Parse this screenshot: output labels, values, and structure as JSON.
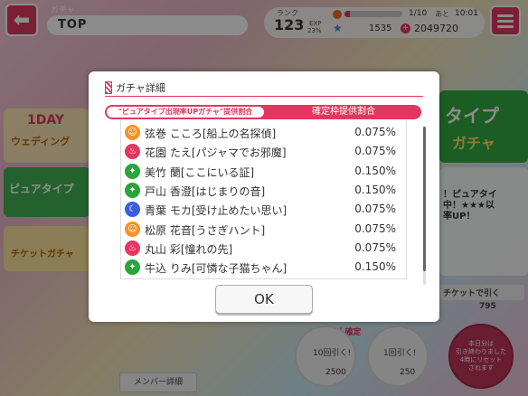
{
  "header": {
    "section_label": "ガチャ",
    "breadcrumb": "TOP"
  },
  "status": {
    "rank_label": "ランク",
    "rank": "123",
    "exp_label": "EXP",
    "exp_percent": "23%",
    "stamina_fraction": 0.1,
    "stamina_text": "1/10",
    "timer_label": "あと",
    "timer": "10:01",
    "stars": "1535",
    "coins": "2049720"
  },
  "background": {
    "banner_left_1": "1DAY",
    "banner_left_1b": "ウェディング",
    "banner_left_2": "ピュアタイプ",
    "banner_left_3": "チケットガチャ",
    "banner_right_1": "タイプ",
    "banner_right_2": "ガチャ",
    "side_text": "！ピュアタイ\n中！★★★以\n率UP！",
    "ticket_btn": "チケットで引く",
    "ticket_count": "795",
    "guarantee": "3以上1人確定",
    "ten_pull_label": "10回引く!",
    "ten_pull_cost": "2500",
    "one_pull_label": "1回引く!",
    "one_pull_cost": "250",
    "daily_label": "本日分は\n引き終わりました\n4時にリセット\nされます",
    "member_detail": "メンバー詳細"
  },
  "dialog": {
    "title": "ガチャ詳細",
    "tab_left": "\"ピュアタイプ出現率UPガチャ\"提供割合",
    "tab_right": "確定枠提供割合",
    "ok_label": "OK",
    "rows": [
      {
        "name": "弦巻 こころ[船上の名探偵]",
        "rate": "0.075%",
        "attr": "happy",
        "color": "#f5922b"
      },
      {
        "name": "花園 たえ[パジャマでお邪魔]",
        "rate": "0.075%",
        "attr": "powerful",
        "color": "#e2375f"
      },
      {
        "name": "美竹 蘭[ここにいる証]",
        "rate": "0.150%",
        "attr": "pure",
        "color": "#2aa53b"
      },
      {
        "name": "戸山 香澄[はじまりの音]",
        "rate": "0.150%",
        "attr": "pure",
        "color": "#2aa53b"
      },
      {
        "name": "青葉 モカ[受け止めたい思い]",
        "rate": "0.075%",
        "attr": "cool",
        "color": "#3b5ee0"
      },
      {
        "name": "松原 花音[うさぎハント]",
        "rate": "0.075%",
        "attr": "happy",
        "color": "#f5922b"
      },
      {
        "name": "丸山 彩[憧れの先]",
        "rate": "0.075%",
        "attr": "powerful",
        "color": "#e2375f"
      },
      {
        "name": "牛込 りみ[可憐な子猫ちゃん]",
        "rate": "0.150%",
        "attr": "pure",
        "color": "#2aa53b"
      }
    ]
  },
  "colors": {
    "accent": "#e2375f",
    "happy": "#f5922b",
    "pure": "#2aa53b",
    "cool": "#3b5ee0"
  }
}
